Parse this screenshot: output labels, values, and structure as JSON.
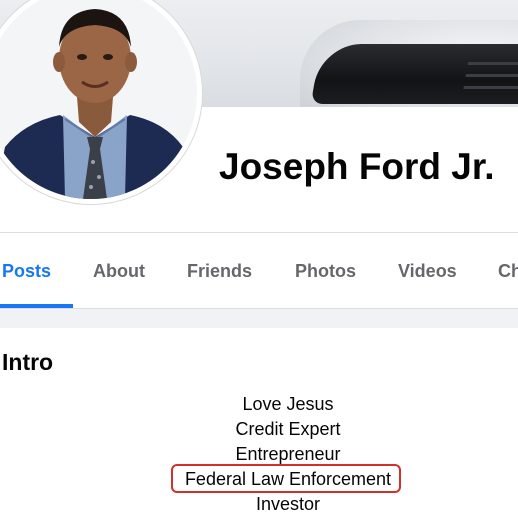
{
  "profile": {
    "name": "Joseph Ford Jr."
  },
  "tabs": [
    {
      "label": "Posts",
      "active": true
    },
    {
      "label": "About",
      "active": false
    },
    {
      "label": "Friends",
      "active": false
    },
    {
      "label": "Photos",
      "active": false
    },
    {
      "label": "Videos",
      "active": false
    },
    {
      "label": "Ch",
      "active": false
    }
  ],
  "intro": {
    "title": "Intro",
    "bio": [
      "Love Jesus",
      "Credit Expert",
      "Entrepreneur",
      "Federal Law Enforcement",
      "Investor"
    ],
    "highlighted_line": "Federal Law Enforcement"
  },
  "colors": {
    "accent": "#1877f2",
    "tab_inactive": "#65676b",
    "text": "#050505",
    "highlight_border": "#d0312d",
    "section_gap": "#f0f2f5"
  },
  "icons": {
    "avatar": "profile-photo"
  }
}
